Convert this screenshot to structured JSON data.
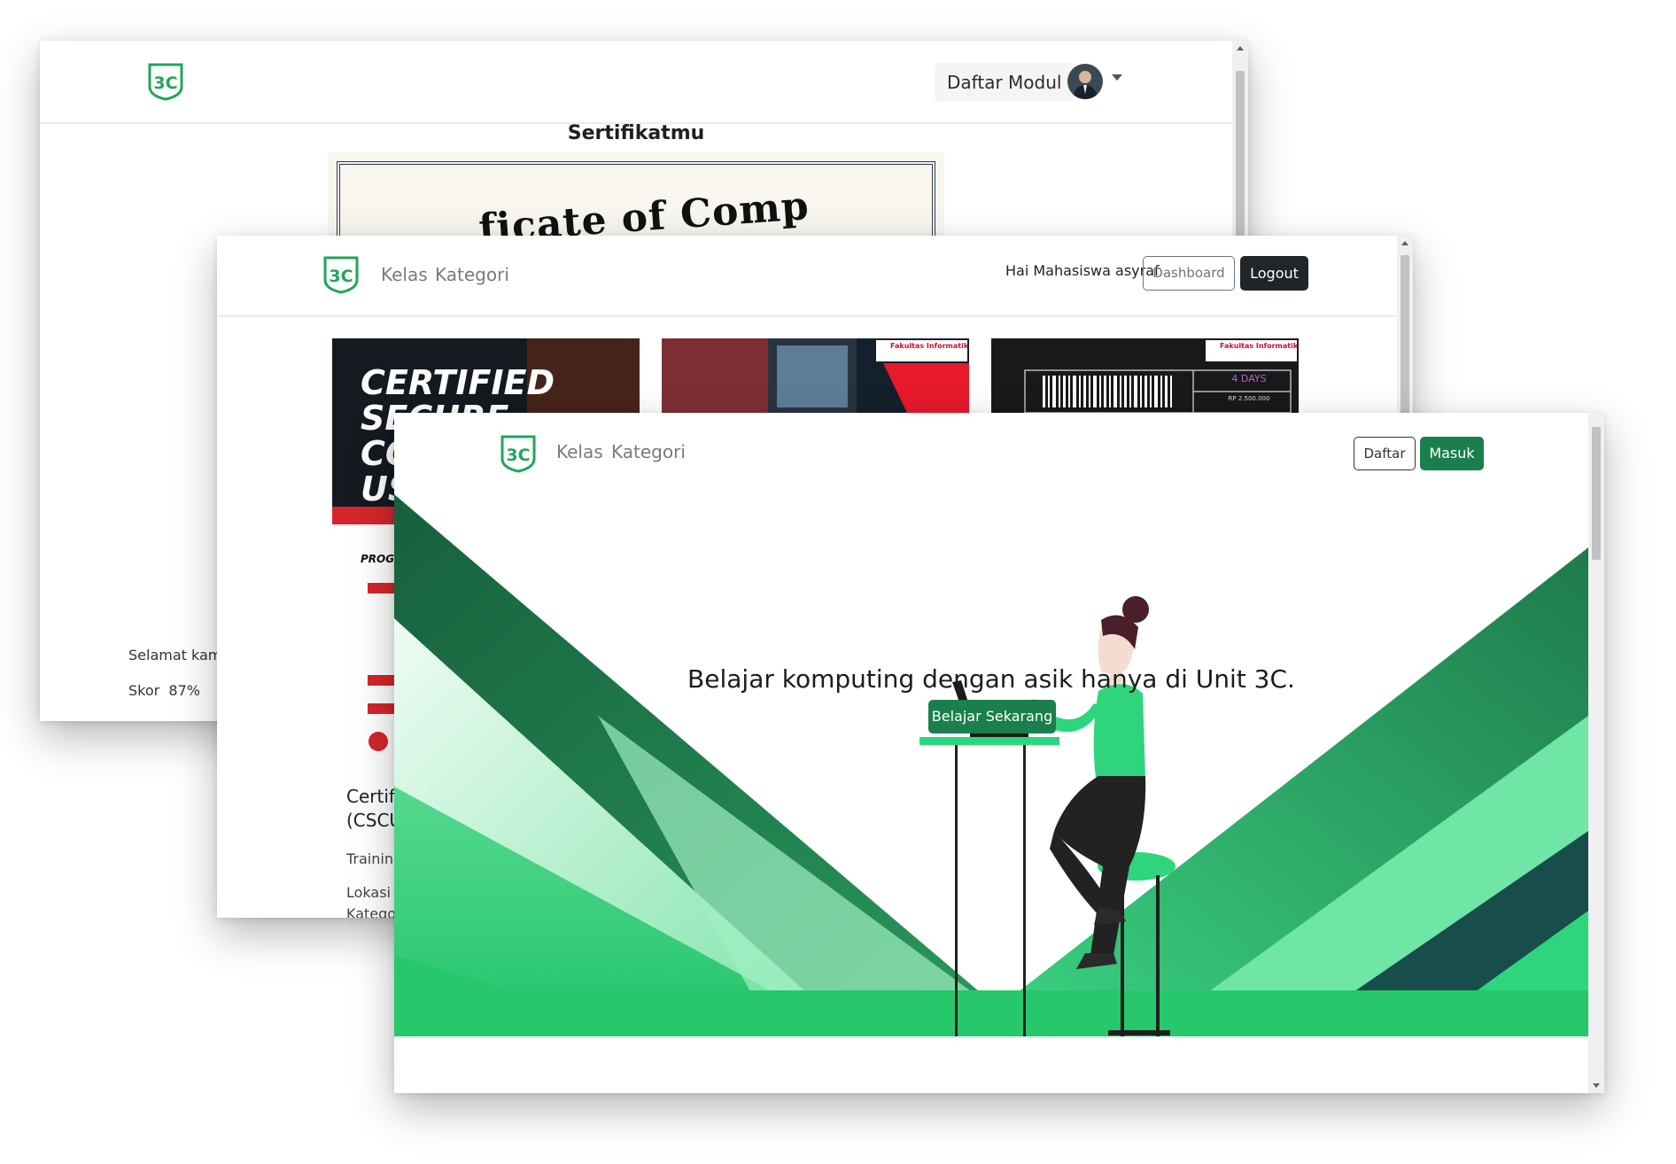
{
  "colors": {
    "brand_green": "#198754",
    "hero_dark": "#1d6b45",
    "hero_mid": "#2fc16c",
    "hero_light": "#8ee6b4",
    "button_dark": "#212529"
  },
  "certificate_window": {
    "nav": {
      "logo": "3C",
      "modules_label": "Daftar Modul"
    },
    "title": "Sertifikatmu",
    "certificate_text": "ficate of Comp",
    "congrats_text": "Selamat kamu",
    "score_label": "Skor",
    "score_value": "87%"
  },
  "courses_window": {
    "nav": {
      "logo": "3C",
      "links": [
        "Kelas",
        "Kategori"
      ],
      "greeting": "Hai Mahasiswa asyraf",
      "dashboard_label": "Dashboard",
      "logout_label": "Logout"
    },
    "cards": [
      {
        "banner_text_1": "CERTIFIED",
        "banner_text_2": "SECURE",
        "banner_text_3": "CO",
        "banner_text_4": "US",
        "program_label": "PROGRA",
        "title_line_1": "Certifi",
        "title_line_2": "(CSCU",
        "line_1": "Training",
        "line_2": "Lokasi",
        "line_3": "Kategor"
      },
      {
        "badge": "Fakultas Informatika"
      },
      {
        "badge": "Fakultas Informatika",
        "days": "4 DAYS",
        "price": "RP 2.500.000"
      }
    ]
  },
  "landing_window": {
    "nav": {
      "logo": "3C",
      "links": [
        "Kelas",
        "Kategori"
      ],
      "register_label": "Daftar",
      "login_label": "Masuk"
    },
    "hero_title": "Belajar komputing dengan asik hanya di Unit 3C.",
    "cta_label": "Belajar Sekarang"
  }
}
